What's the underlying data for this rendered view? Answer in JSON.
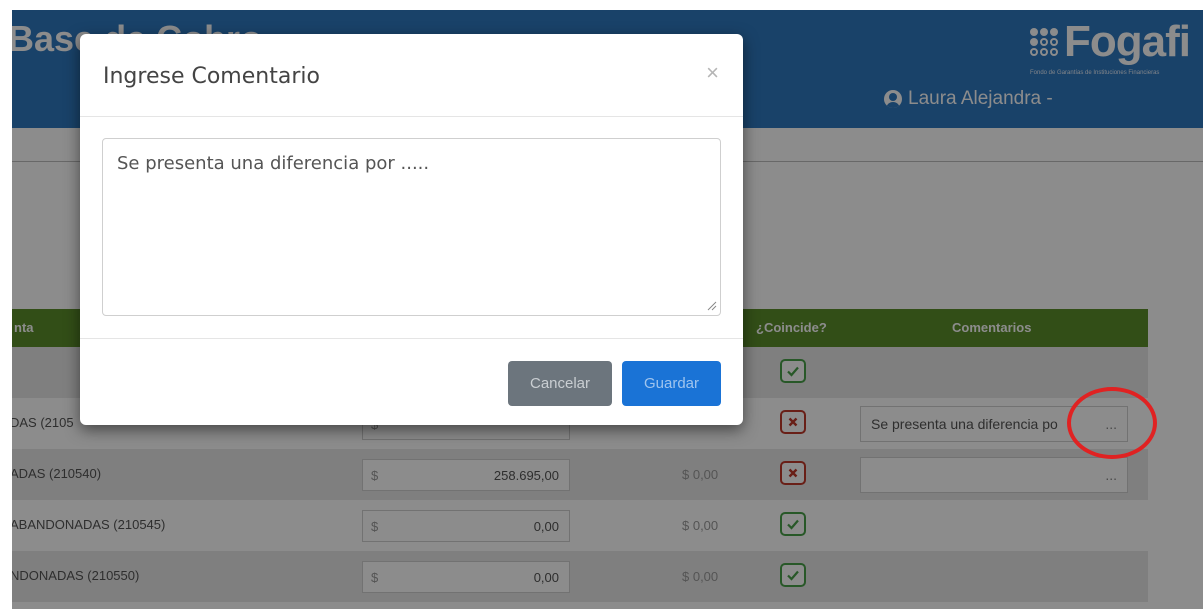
{
  "header": {
    "app_title": "Base de Cobro",
    "logo_text": "Fogafi",
    "logo_subtitle": "Fondo de Garantías de Instituciones Financieras",
    "user_name": "Laura Alejandra -"
  },
  "table": {
    "headers": {
      "cuenta": "nta",
      "coincide": "¿Coincide?",
      "comentarios": "Comentarios"
    },
    "rows": [
      {
        "account": "",
        "currency": "",
        "amount": "",
        "difference": "",
        "match": "yes",
        "comment": ""
      },
      {
        "account": "DAS (2105",
        "currency": "$",
        "amount": "",
        "difference": "",
        "match": "no",
        "comment": "Se presenta una diferencia po",
        "more": "..."
      },
      {
        "account": "ADAS (210540)",
        "currency": "$",
        "amount": "258.695,00",
        "difference": "$ 0,00",
        "match": "no",
        "comment": "",
        "more": "..."
      },
      {
        "account": "ABANDONADAS (210545)",
        "currency": "$",
        "amount": "0,00",
        "difference": "$ 0,00",
        "match": "yes",
        "comment": ""
      },
      {
        "account": "NDONADAS (210550)",
        "currency": "$",
        "amount": "0,00",
        "difference": "$ 0,00",
        "match": "yes",
        "comment": ""
      }
    ]
  },
  "modal": {
    "title": "Ingrese Comentario",
    "close_glyph": "×",
    "comment_value": "Se presenta una diferencia por .....",
    "cancel_label": "Cancelar",
    "save_label": "Guardar"
  },
  "colors": {
    "header_blue": "#2f78c0",
    "table_header_green": "#5c8f2a",
    "check_green": "#4aa04a",
    "cross_red": "#c0392b",
    "annotation_red": "#e02222",
    "save_blue": "#1a73d6",
    "cancel_gray": "#6c757d"
  },
  "icons": {
    "user": "user-circle-icon",
    "check": "checkmark-icon",
    "cross": "cross-icon",
    "close": "close-icon"
  }
}
